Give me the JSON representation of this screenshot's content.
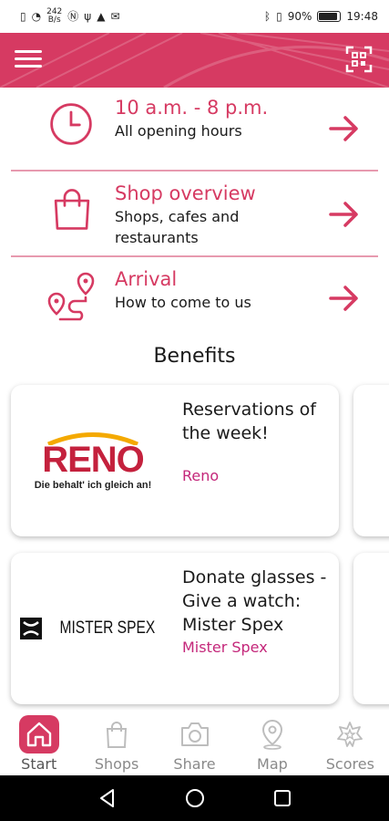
{
  "status_bar": {
    "left_items": [
      "sim-icon",
      "wifi-icon",
      "242 B/s",
      "nfc-icon",
      "usb-icon",
      "android-icon",
      "mail-icon"
    ],
    "speed": "242",
    "speed_unit": "B/s",
    "battery": "90%",
    "time": "19:48"
  },
  "header": {
    "menu_icon": "hamburger-menu-icon",
    "qr_icon": "qr-scanner-icon"
  },
  "info_rows": [
    {
      "title": "10 a.m. - 8 p.m.",
      "subtitle": "All opening hours",
      "icon": "clock-icon"
    },
    {
      "title": "Shop overview",
      "subtitle": "Shops, cafes and restaurants",
      "icon": "shopping-bag-icon"
    },
    {
      "title": "Arrival",
      "subtitle": "How to come to us",
      "icon": "route-icon"
    }
  ],
  "benefits": {
    "title": "Benefits",
    "cards": [
      {
        "logo_word": "RENO",
        "logo_tagline": "Die behalt' ich gleich an!",
        "title": "Reservations of the week!",
        "brand": "Reno"
      },
      {
        "logo_word": "MISTER SPEX",
        "title": "Donate glasses - Give a watch: Mister Spex",
        "brand": "Mister Spex"
      }
    ]
  },
  "bottom_nav": [
    {
      "label": "Start",
      "icon": "home-icon",
      "active": true
    },
    {
      "label": "Shops",
      "icon": "shopping-bag-icon",
      "active": false
    },
    {
      "label": "Share",
      "icon": "camera-icon",
      "active": false
    },
    {
      "label": "Map",
      "icon": "map-pin-icon",
      "active": false
    },
    {
      "label": "Scores",
      "icon": "star-badge-icon",
      "active": false
    }
  ],
  "colors": {
    "accent": "#d63a62",
    "brand_text": "#c4277a",
    "divider": "#e79aaf"
  }
}
